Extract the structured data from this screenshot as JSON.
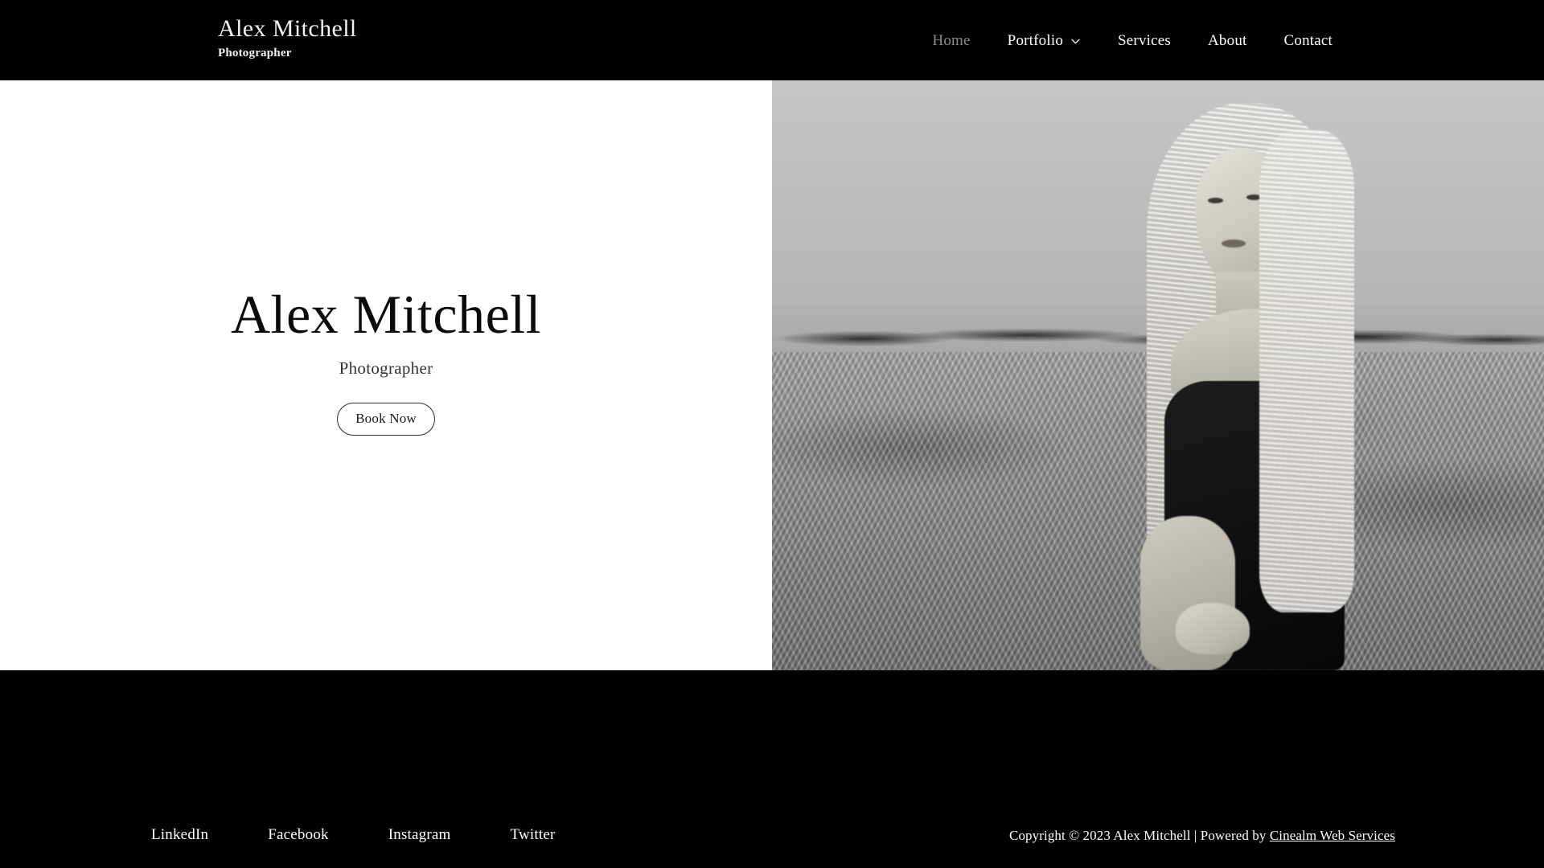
{
  "header": {
    "brand": {
      "name": "Alex Mitchell",
      "tagline": "Photographer"
    },
    "nav": [
      {
        "label": "Home",
        "active": true,
        "has_dropdown": false
      },
      {
        "label": "Portfolio",
        "active": false,
        "has_dropdown": true
      },
      {
        "label": "Services",
        "active": false,
        "has_dropdown": false
      },
      {
        "label": "About",
        "active": false,
        "has_dropdown": false
      },
      {
        "label": "Contact",
        "active": false,
        "has_dropdown": false
      }
    ]
  },
  "hero": {
    "title": "Alex Mitchell",
    "subtitle": "Photographer",
    "cta_label": "Book Now",
    "image_alt": "Black and white portrait of a blonde woman in a black off-shoulder top standing in a field"
  },
  "footer": {
    "social": [
      {
        "label": "LinkedIn"
      },
      {
        "label": "Facebook"
      },
      {
        "label": "Instagram"
      },
      {
        "label": "Twitter"
      }
    ],
    "copyright_text": "Copyright © 2023 Alex Mitchell | Powered by ",
    "credit_link": "Cinealm Web Services"
  },
  "colors": {
    "header_bg": "#000000",
    "footer_bg": "#000000",
    "hero_left_bg": "#ffffff",
    "nav_text": "#ffffff",
    "nav_active_text": "#8a8a8a",
    "heading_text": "#0a0a0a",
    "button_border": "#2b2b2b"
  }
}
